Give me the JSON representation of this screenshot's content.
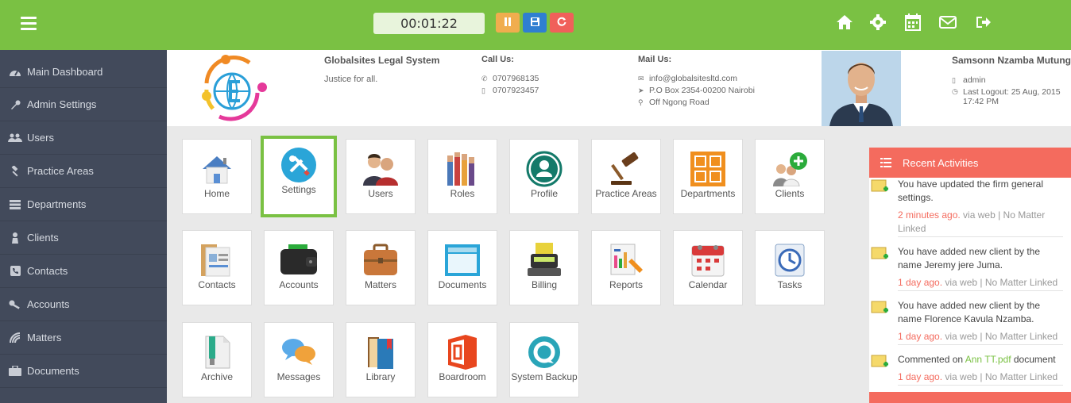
{
  "timer": "00:01:22",
  "sidebar": {
    "items": [
      {
        "label": "Main Dashboard",
        "icon": "dashboard-icon"
      },
      {
        "label": "Admin Settings",
        "icon": "wrench-icon"
      },
      {
        "label": "Users",
        "icon": "users-icon"
      },
      {
        "label": "Practice Areas",
        "icon": "gavel-icon"
      },
      {
        "label": "Departments",
        "icon": "server-icon"
      },
      {
        "label": "Clients",
        "icon": "user-icon"
      },
      {
        "label": "Contacts",
        "icon": "phone-icon"
      },
      {
        "label": "Accounts",
        "icon": "key-icon"
      },
      {
        "label": "Matters",
        "icon": "signal-icon"
      },
      {
        "label": "Documents",
        "icon": "briefcase-icon"
      }
    ]
  },
  "header": {
    "firm_name": "Globalsites Legal System",
    "tagline": "Justice for all.",
    "call_heading": "Call Us:",
    "phone1": "0707968135",
    "phone2": "0707923457",
    "mail_heading": "Mail Us:",
    "email": "info@globalsitesltd.com",
    "po_box": "P.O Box 2354-00200 Nairobi",
    "address": "Off Ngong Road",
    "user_name": "Samsonn Nzamba Mutungi",
    "role": "admin",
    "last_logout": "Last Logout: 25 Aug, 2015",
    "last_logout_time": "17:42 PM"
  },
  "tiles": [
    {
      "label": "Home",
      "icon": "home-icon"
    },
    {
      "label": "Settings",
      "icon": "settings-icon"
    },
    {
      "label": "Users",
      "icon": "users-icon"
    },
    {
      "label": "Roles",
      "icon": "roles-icon"
    },
    {
      "label": "Profile",
      "icon": "profile-icon"
    },
    {
      "label": "Practice Areas",
      "icon": "gavel-icon"
    },
    {
      "label": "Departments",
      "icon": "departments-icon"
    },
    {
      "label": "Clients",
      "icon": "clients-icon"
    },
    {
      "label": "Contacts",
      "icon": "contacts-icon"
    },
    {
      "label": "Accounts",
      "icon": "wallet-icon"
    },
    {
      "label": "Matters",
      "icon": "briefcase-icon"
    },
    {
      "label": "Documents",
      "icon": "documents-icon"
    },
    {
      "label": "Billing",
      "icon": "billing-icon"
    },
    {
      "label": "Reports",
      "icon": "reports-icon"
    },
    {
      "label": "Calendar",
      "icon": "calendar-icon"
    },
    {
      "label": "Tasks",
      "icon": "tasks-icon"
    },
    {
      "label": "Archive",
      "icon": "archive-icon"
    },
    {
      "label": "Messages",
      "icon": "messages-icon"
    },
    {
      "label": "Library",
      "icon": "library-icon"
    },
    {
      "label": "Boardroom",
      "icon": "boardroom-icon"
    },
    {
      "label": "System Backup",
      "icon": "backup-icon"
    }
  ],
  "recent": {
    "title": "Recent Activities",
    "items": [
      {
        "text": "You have updated the firm general settings.",
        "time": "2 minutes ago.",
        "source": " via web | No Matter Linked"
      },
      {
        "text": "You have added new client by the name Jeremy jere Juma.",
        "time": "1 day ago.",
        "source": " via web | No Matter Linked"
      },
      {
        "text": "You have added new client by the name Florence Kavula Nzamba.",
        "time": "1 day ago.",
        "source": " via web | No Matter Linked"
      },
      {
        "text_before": "Commented on ",
        "link": "Ann TT.pdf",
        "text_after": " document",
        "time": "1 day ago.",
        "source": " via web | No Matter Linked"
      }
    ]
  },
  "colors": {
    "topbar": "#7ac143",
    "sidebar": "#424a5b",
    "accent": "#f46b5e"
  }
}
